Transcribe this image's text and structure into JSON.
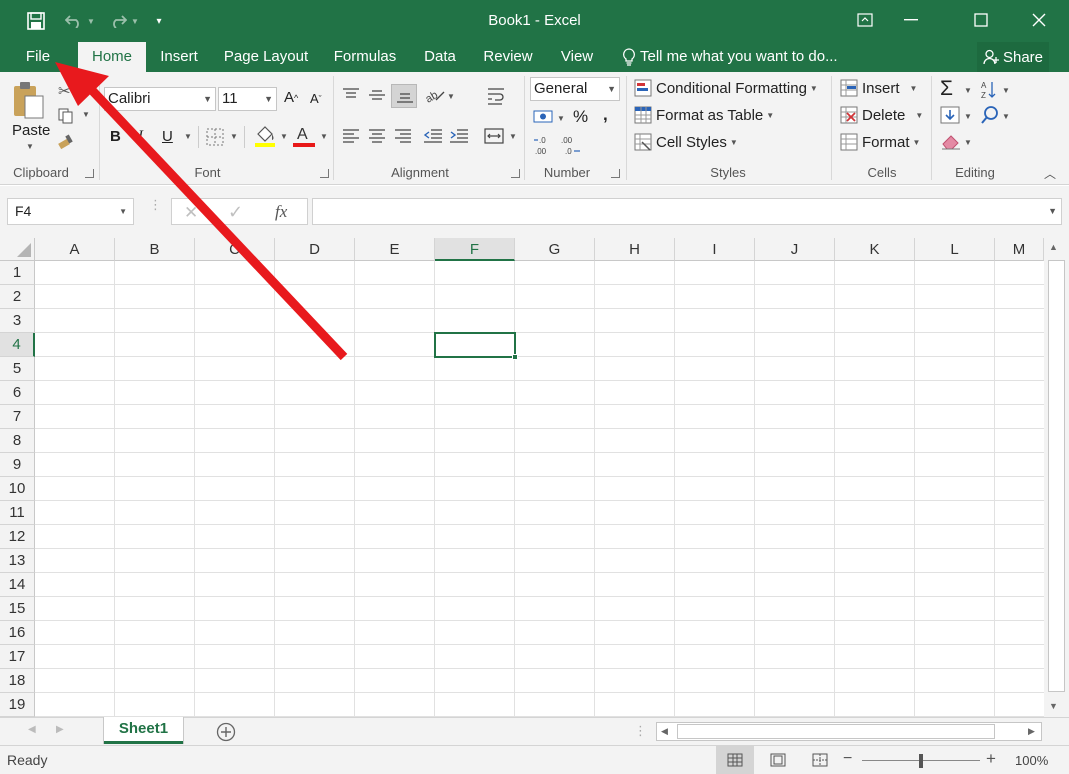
{
  "window": {
    "title": "Book1 - Excel"
  },
  "tabs": [
    {
      "label": "File"
    },
    {
      "label": "Home"
    },
    {
      "label": "Insert"
    },
    {
      "label": "Page Layout"
    },
    {
      "label": "Formulas"
    },
    {
      "label": "Data"
    },
    {
      "label": "Review"
    },
    {
      "label": "View"
    }
  ],
  "tell_me": "Tell me what you want to do...",
  "share": "Share",
  "ribbon": {
    "clipboard": {
      "paste": "Paste",
      "label": "Clipboard"
    },
    "font": {
      "name": "Calibri",
      "size": "11",
      "label": "Font",
      "bold": "B",
      "italic": "I",
      "underline": "U"
    },
    "alignment": {
      "label": "Alignment"
    },
    "number": {
      "format": "General",
      "percent": "%",
      "comma": ",",
      "label": "Number"
    },
    "styles": {
      "conditional": "Conditional Formatting",
      "table": "Format as Table",
      "cell_styles": "Cell Styles",
      "label": "Styles"
    },
    "cells": {
      "insert": "Insert",
      "delete": "Delete",
      "format": "Format",
      "label": "Cells"
    },
    "editing": {
      "label": "Editing"
    }
  },
  "formula_bar": {
    "name_box": "F4",
    "fx": "fx",
    "value": ""
  },
  "grid": {
    "columns": [
      "A",
      "B",
      "C",
      "D",
      "E",
      "F",
      "G",
      "H",
      "I",
      "J",
      "K",
      "L",
      "M"
    ],
    "rows": [
      "1",
      "2",
      "3",
      "4",
      "5",
      "6",
      "7",
      "8",
      "9",
      "10",
      "11",
      "12",
      "13",
      "14",
      "15",
      "16",
      "17",
      "18",
      "19"
    ],
    "selected_cell": "F4"
  },
  "sheets": [
    {
      "label": "Sheet1"
    }
  ],
  "status": {
    "ready": "Ready",
    "zoom": "100%",
    "zoom_level": 1.0
  },
  "colors": {
    "accent": "#217346",
    "annotation_arrow": "#e8191d"
  }
}
